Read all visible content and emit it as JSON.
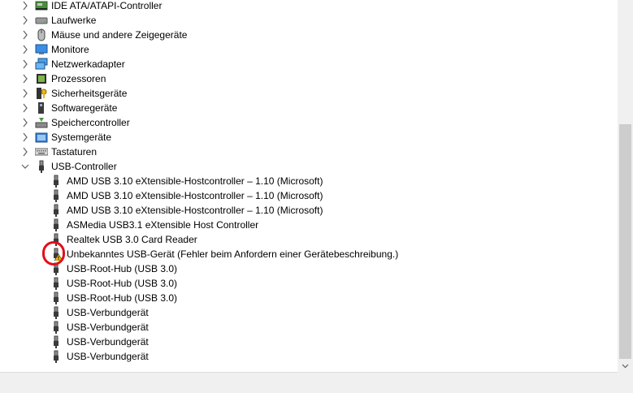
{
  "categories": [
    {
      "label": "IDE ATA/ATAPI-Controller",
      "icon": "ide-controller-icon",
      "expanded": false
    },
    {
      "label": "Laufwerke",
      "icon": "disk-drive-icon",
      "expanded": false
    },
    {
      "label": "Mäuse und andere Zeigegeräte",
      "icon": "mouse-icon",
      "expanded": false
    },
    {
      "label": "Monitore",
      "icon": "monitor-icon",
      "expanded": false
    },
    {
      "label": "Netzwerkadapter",
      "icon": "network-adapter-icon",
      "expanded": false
    },
    {
      "label": "Prozessoren",
      "icon": "processor-icon",
      "expanded": false
    },
    {
      "label": "Sicherheitsgeräte",
      "icon": "security-device-icon",
      "expanded": false
    },
    {
      "label": "Softwaregeräte",
      "icon": "software-device-icon",
      "expanded": false
    },
    {
      "label": "Speichercontroller",
      "icon": "storage-controller-icon",
      "expanded": false
    },
    {
      "label": "Systemgeräte",
      "icon": "system-device-icon",
      "expanded": false
    },
    {
      "label": "Tastaturen",
      "icon": "keyboard-icon",
      "expanded": false
    },
    {
      "label": "USB-Controller",
      "icon": "usb-icon",
      "expanded": true
    }
  ],
  "usb_devices": [
    {
      "label": "AMD USB 3.10 eXtensible-Hostcontroller – 1.10 (Microsoft)",
      "warning": false
    },
    {
      "label": "AMD USB 3.10 eXtensible-Hostcontroller – 1.10 (Microsoft)",
      "warning": false
    },
    {
      "label": "AMD USB 3.10 eXtensible-Hostcontroller – 1.10 (Microsoft)",
      "warning": false
    },
    {
      "label": "ASMedia USB3.1 eXtensible Host Controller",
      "warning": false
    },
    {
      "label": "Realtek USB 3.0 Card Reader",
      "warning": false
    },
    {
      "label": "Unbekanntes USB-Gerät (Fehler beim Anfordern einer Gerätebeschreibung.)",
      "warning": true
    },
    {
      "label": "USB-Root-Hub (USB 3.0)",
      "warning": false
    },
    {
      "label": "USB-Root-Hub (USB 3.0)",
      "warning": false
    },
    {
      "label": "USB-Root-Hub (USB 3.0)",
      "warning": false
    },
    {
      "label": "USB-Verbundgerät",
      "warning": false
    },
    {
      "label": "USB-Verbundgerät",
      "warning": false
    },
    {
      "label": "USB-Verbundgerät",
      "warning": false
    },
    {
      "label": "USB-Verbundgerät",
      "warning": false
    }
  ],
  "colors": {
    "chevron": "#606060",
    "warning_yellow": "#f2c200",
    "highlight_circle": "#e0101a"
  }
}
